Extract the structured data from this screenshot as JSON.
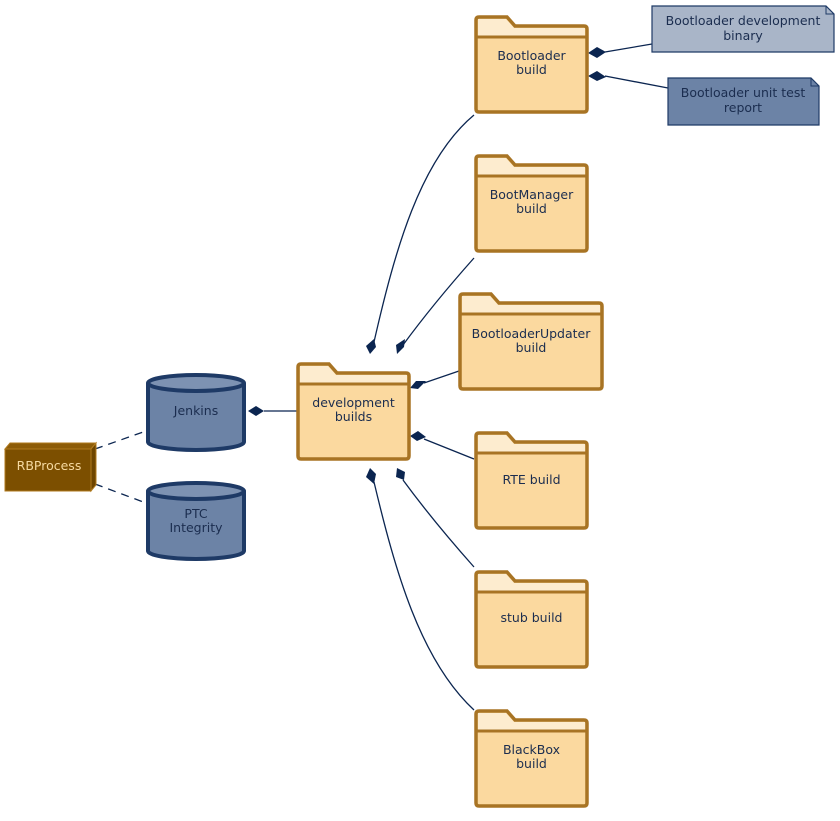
{
  "colors": {
    "folder_fill": "#fbd99f",
    "folder_tab_fill": "#fdeccf",
    "folder_stroke": "#a87424",
    "db_fill": "#6c83a6",
    "db_stroke": "#1e3a66",
    "node_fill": "#7c4f00",
    "node_stroke": "#b07a1e",
    "artifact_light_fill": "#a9b5c8",
    "artifact_dark_fill": "#6c83a6",
    "artifact_stroke": "#1e3a66",
    "connector": "#0b2550"
  },
  "nodes": {
    "rbprocess": "RBProcess",
    "jenkins": "Jenkins",
    "ptc_integrity": [
      "PTC",
      "Integrity"
    ],
    "development_builds": [
      "development",
      "builds"
    ],
    "bootloader_build": [
      "Bootloader",
      "build"
    ],
    "bootmanager_build": [
      "BootManager",
      "build"
    ],
    "bootloaderupdater_build": [
      "BootloaderUpdater",
      "build"
    ],
    "rte_build": [
      "RTE build"
    ],
    "stub_build": [
      "stub build"
    ],
    "blackbox_build": [
      "BlackBox",
      "build"
    ],
    "bootloader_dev_binary": [
      "Bootloader development",
      "binary"
    ],
    "bootloader_unit_test_report": [
      "Bootloader unit test",
      "report"
    ]
  },
  "relations": [
    {
      "from": "RBProcess",
      "to": "Jenkins",
      "type": "dashed"
    },
    {
      "from": "RBProcess",
      "to": "PTC Integrity",
      "type": "dashed"
    },
    {
      "from": "Jenkins",
      "to": "development builds",
      "type": "composition"
    },
    {
      "from": "development builds",
      "to": "Bootloader build",
      "type": "composition"
    },
    {
      "from": "development builds",
      "to": "BootManager build",
      "type": "composition"
    },
    {
      "from": "development builds",
      "to": "BootloaderUpdater build",
      "type": "composition"
    },
    {
      "from": "development builds",
      "to": "RTE build",
      "type": "composition"
    },
    {
      "from": "development builds",
      "to": "stub build",
      "type": "composition"
    },
    {
      "from": "development builds",
      "to": "BlackBox build",
      "type": "composition"
    },
    {
      "from": "Bootloader build",
      "to": "Bootloader development binary",
      "type": "composition"
    },
    {
      "from": "Bootloader build",
      "to": "Bootloader unit test report",
      "type": "composition"
    }
  ]
}
